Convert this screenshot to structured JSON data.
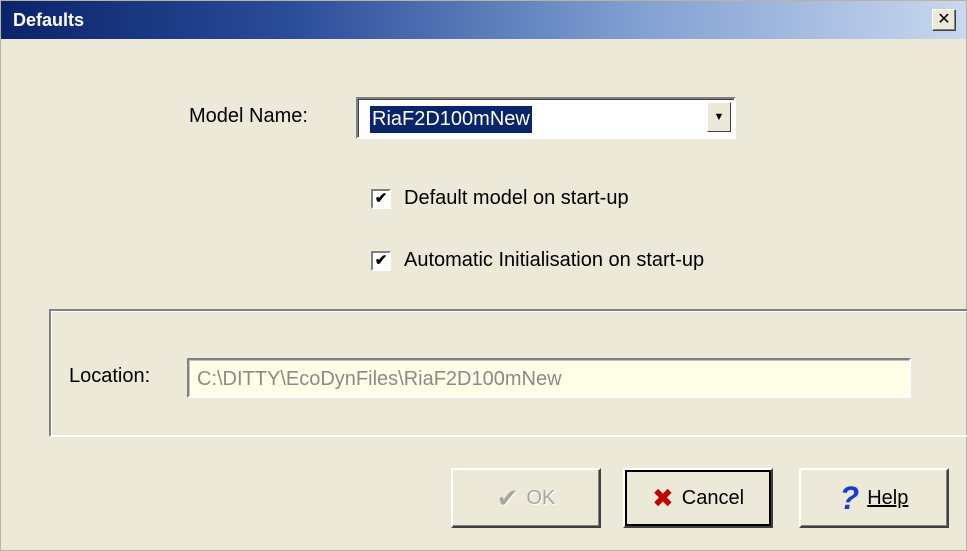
{
  "window": {
    "title": "Defaults",
    "close_glyph": "✕"
  },
  "model": {
    "label": "Model Name:",
    "value": "RiaF2D100mNew",
    "arrow_icon": "▼"
  },
  "options": [
    {
      "label": "Default model on start-up",
      "checked": true,
      "check_glyph": "✔"
    },
    {
      "label": "Automatic Initialisation on start-up",
      "checked": true,
      "check_glyph": "✔"
    }
  ],
  "location": {
    "label": "Location:",
    "value": "C:\\DITTY\\EcoDynFiles\\RiaF2D100mNew"
  },
  "buttons": {
    "ok": {
      "label": "OK",
      "icon": "✔",
      "enabled": false
    },
    "cancel": {
      "label": "Cancel",
      "icon": "✖"
    },
    "help": {
      "label": "Help",
      "icon": "?"
    }
  },
  "colors": {
    "titlebar_start": "#0a246a",
    "cancel_icon": "#c00000",
    "help_icon": "#1a3cc8",
    "ok_disabled": "#a8a6a0"
  }
}
